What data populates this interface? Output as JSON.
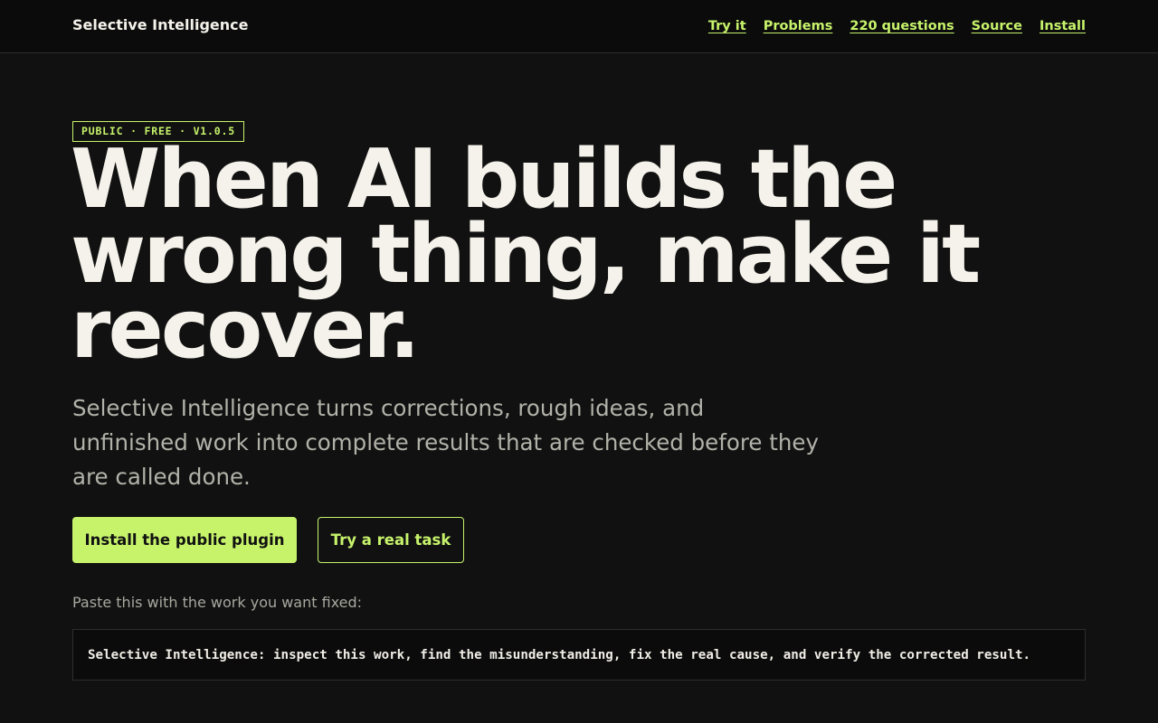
{
  "header": {
    "brand": "Selective Intelligence",
    "nav": [
      {
        "label": "Try it"
      },
      {
        "label": "Problems"
      },
      {
        "label": "220 questions"
      },
      {
        "label": "Source"
      },
      {
        "label": "Install"
      }
    ]
  },
  "hero": {
    "badge": "PUBLIC · FREE · V1.0.5",
    "headline": "When AI builds the wrong thing, make it recover.",
    "subtitle": "Selective Intelligence turns corrections, rough ideas, and unfinished work into complete results that are checked before they are called done.",
    "primary_cta": "Install the public plugin",
    "secondary_cta": "Try a real task",
    "paste_label": "Paste this with the work you want fixed:",
    "prompt": "Selective Intelligence: inspect this work, find the misunderstanding, fix the real cause, and verify the corrected result."
  },
  "colors": {
    "background": "#111111",
    "accent": "#c7f36b",
    "text": "#f4f2ea",
    "muted": "#b2b2aa"
  }
}
